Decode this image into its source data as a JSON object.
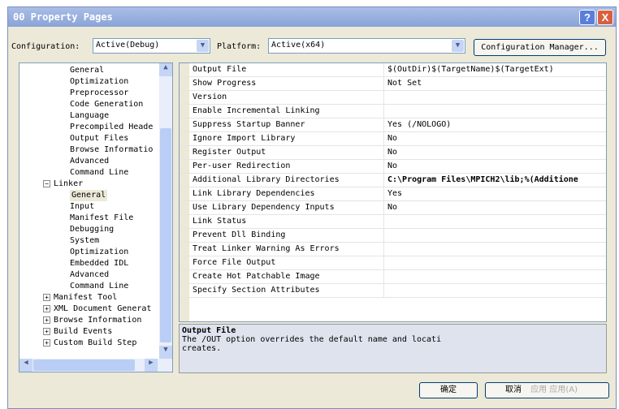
{
  "title": "00 Property Pages",
  "help_label": "?",
  "close_label": "X",
  "config_label": "Configuration:",
  "config_value": "Active(Debug)",
  "platform_label": "Platform:",
  "platform_value": "Active(x64)",
  "config_manager": "Configuration Manager...",
  "tree": [
    {
      "label": "General",
      "level": 2
    },
    {
      "label": "Optimization",
      "level": 2
    },
    {
      "label": "Preprocessor",
      "level": 2
    },
    {
      "label": "Code Generation",
      "level": 2
    },
    {
      "label": "Language",
      "level": 2
    },
    {
      "label": "Precompiled Heade",
      "level": 2
    },
    {
      "label": "Output Files",
      "level": 2
    },
    {
      "label": "Browse Informatio",
      "level": 2
    },
    {
      "label": "Advanced",
      "level": 2
    },
    {
      "label": "Command Line",
      "level": 2
    },
    {
      "label": "Linker",
      "level": 1,
      "expander": "−"
    },
    {
      "label": "General",
      "level": 2,
      "selected": true
    },
    {
      "label": "Input",
      "level": 2
    },
    {
      "label": "Manifest File",
      "level": 2
    },
    {
      "label": "Debugging",
      "level": 2
    },
    {
      "label": "System",
      "level": 2
    },
    {
      "label": "Optimization",
      "level": 2
    },
    {
      "label": "Embedded IDL",
      "level": 2
    },
    {
      "label": "Advanced",
      "level": 2
    },
    {
      "label": "Command Line",
      "level": 2
    },
    {
      "label": "Manifest Tool",
      "level": 1,
      "expander": "+"
    },
    {
      "label": "XML Document Generat",
      "level": 1,
      "expander": "+"
    },
    {
      "label": "Browse Information",
      "level": 1,
      "expander": "+"
    },
    {
      "label": "Build Events",
      "level": 1,
      "expander": "+"
    },
    {
      "label": "Custom Build Step",
      "level": 1,
      "expander": "+"
    }
  ],
  "properties": [
    {
      "name": "Output File",
      "value": "$(OutDir)$(TargetName)$(TargetExt)"
    },
    {
      "name": "Show Progress",
      "value": "Not Set"
    },
    {
      "name": "Version",
      "value": ""
    },
    {
      "name": "Enable Incremental Linking",
      "value": ""
    },
    {
      "name": "Suppress Startup Banner",
      "value": "Yes (/NOLOGO)"
    },
    {
      "name": "Ignore Import Library",
      "value": "No"
    },
    {
      "name": "Register Output",
      "value": "No"
    },
    {
      "name": "Per-user Redirection",
      "value": "No"
    },
    {
      "name": "Additional Library Directories",
      "value": "C:\\Program Files\\MPICH2\\lib;%(Additione",
      "bold": true
    },
    {
      "name": "Link Library Dependencies",
      "value": "Yes"
    },
    {
      "name": "Use Library Dependency Inputs",
      "value": "No"
    },
    {
      "name": "Link Status",
      "value": ""
    },
    {
      "name": "Prevent Dll Binding",
      "value": ""
    },
    {
      "name": "Treat Linker Warning As Errors",
      "value": ""
    },
    {
      "name": "Force File Output",
      "value": ""
    },
    {
      "name": "Create Hot Patchable Image",
      "value": ""
    },
    {
      "name": "Specify Section Attributes",
      "value": ""
    }
  ],
  "desc_title": "Output File",
  "desc_text": "The /OUT option overrides the default name and locati",
  "desc_text2": "creates.",
  "ok": "确定",
  "cancel": "取消",
  "apply": "应用 应用(A)"
}
